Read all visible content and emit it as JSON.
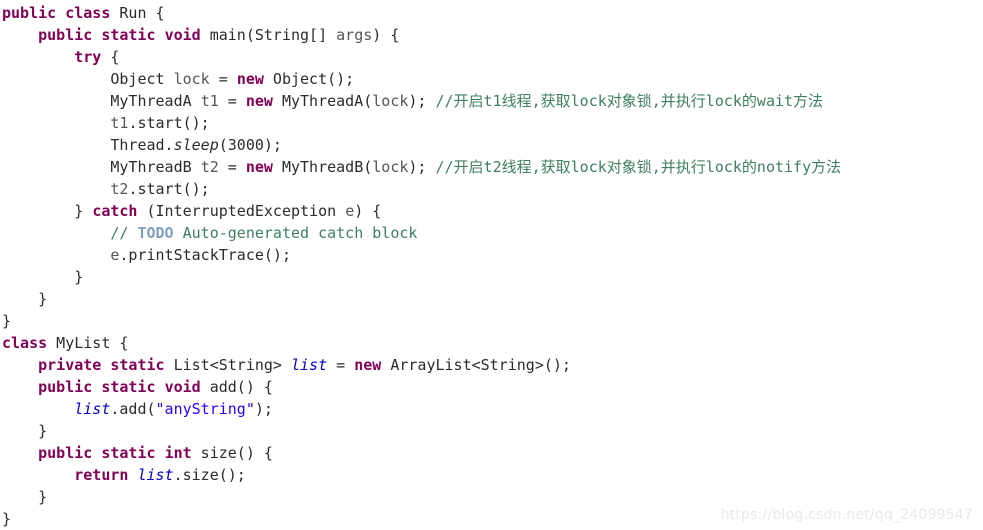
{
  "editor": {
    "background_color": "#ffffff",
    "default_text_color": "#2b2b2b",
    "keyword_color": "#7f0055",
    "comment_color": "#3f7f5f",
    "todo_color": "#7f9fbf",
    "string_color": "#2a00ff",
    "static_field_color": "#0000c0",
    "language": "java"
  },
  "watermark": {
    "text": "https://blog.csdn.net/qq_24099547",
    "color": "#e8e8e8"
  },
  "code": {
    "lines": [
      {
        "indent": 0,
        "tokens": [
          {
            "t": "public",
            "k": "keyword"
          },
          {
            "t": " ",
            "k": "plain"
          },
          {
            "t": "class",
            "k": "keyword"
          },
          {
            "t": " Run {",
            "k": "plain"
          }
        ]
      },
      {
        "indent": 1,
        "tokens": [
          {
            "t": "public",
            "k": "keyword"
          },
          {
            "t": " ",
            "k": "plain"
          },
          {
            "t": "static",
            "k": "keyword"
          },
          {
            "t": " ",
            "k": "plain"
          },
          {
            "t": "void",
            "k": "keyword"
          },
          {
            "t": " main(String[] ",
            "k": "plain"
          },
          {
            "t": "args",
            "k": "local"
          },
          {
            "t": ") {",
            "k": "plain"
          }
        ]
      },
      {
        "indent": 2,
        "tokens": [
          {
            "t": "try",
            "k": "keyword"
          },
          {
            "t": " {",
            "k": "plain"
          }
        ]
      },
      {
        "indent": 3,
        "tokens": [
          {
            "t": "Object ",
            "k": "plain"
          },
          {
            "t": "lock",
            "k": "local"
          },
          {
            "t": " = ",
            "k": "plain"
          },
          {
            "t": "new",
            "k": "keyword"
          },
          {
            "t": " Object();",
            "k": "plain"
          }
        ]
      },
      {
        "indent": 3,
        "tokens": [
          {
            "t": "MyThreadA ",
            "k": "plain"
          },
          {
            "t": "t1",
            "k": "local"
          },
          {
            "t": " = ",
            "k": "plain"
          },
          {
            "t": "new",
            "k": "keyword"
          },
          {
            "t": " MyThreadA(",
            "k": "plain"
          },
          {
            "t": "lock",
            "k": "local"
          },
          {
            "t": "); ",
            "k": "plain"
          },
          {
            "t": "//开启t1线程,获取lock对象锁,并执行lock的wait方法",
            "k": "comment"
          }
        ]
      },
      {
        "indent": 3,
        "tokens": [
          {
            "t": "t1",
            "k": "local"
          },
          {
            "t": ".start();",
            "k": "plain"
          }
        ]
      },
      {
        "indent": 3,
        "tokens": [
          {
            "t": "Thread.",
            "k": "plain"
          },
          {
            "t": "sleep",
            "k": "static-method"
          },
          {
            "t": "(3000);",
            "k": "plain"
          }
        ]
      },
      {
        "indent": 3,
        "tokens": [
          {
            "t": "MyThreadB ",
            "k": "plain"
          },
          {
            "t": "t2",
            "k": "local"
          },
          {
            "t": " = ",
            "k": "plain"
          },
          {
            "t": "new",
            "k": "keyword"
          },
          {
            "t": " MyThreadB(",
            "k": "plain"
          },
          {
            "t": "lock",
            "k": "local"
          },
          {
            "t": "); ",
            "k": "plain"
          },
          {
            "t": "//开启t2线程,获取lock对象锁,并执行lock的notify方法",
            "k": "comment"
          }
        ]
      },
      {
        "indent": 3,
        "tokens": [
          {
            "t": "t2",
            "k": "local"
          },
          {
            "t": ".start();",
            "k": "plain"
          }
        ]
      },
      {
        "indent": 2,
        "tokens": [
          {
            "t": "} ",
            "k": "plain"
          },
          {
            "t": "catch",
            "k": "keyword"
          },
          {
            "t": " (InterruptedException ",
            "k": "plain"
          },
          {
            "t": "e",
            "k": "local"
          },
          {
            "t": ") {",
            "k": "plain"
          }
        ]
      },
      {
        "indent": 3,
        "tokens": [
          {
            "t": "// ",
            "k": "comment"
          },
          {
            "t": "TODO",
            "k": "todo"
          },
          {
            "t": " Auto-generated catch block",
            "k": "comment"
          }
        ]
      },
      {
        "indent": 3,
        "tokens": [
          {
            "t": "e",
            "k": "local"
          },
          {
            "t": ".printStackTrace();",
            "k": "plain"
          }
        ]
      },
      {
        "indent": 2,
        "tokens": [
          {
            "t": "}",
            "k": "plain"
          }
        ]
      },
      {
        "indent": 1,
        "tokens": [
          {
            "t": "}",
            "k": "plain"
          }
        ]
      },
      {
        "indent": 0,
        "tokens": [
          {
            "t": "}",
            "k": "plain"
          }
        ]
      },
      {
        "indent": 0,
        "tokens": [
          {
            "t": "class",
            "k": "keyword"
          },
          {
            "t": " MyList {",
            "k": "plain"
          }
        ]
      },
      {
        "indent": 1,
        "tokens": [
          {
            "t": "private",
            "k": "keyword"
          },
          {
            "t": " ",
            "k": "plain"
          },
          {
            "t": "static",
            "k": "keyword"
          },
          {
            "t": " List<String> ",
            "k": "plain"
          },
          {
            "t": "list",
            "k": "static-field"
          },
          {
            "t": " = ",
            "k": "plain"
          },
          {
            "t": "new",
            "k": "keyword"
          },
          {
            "t": " ArrayList<String>();",
            "k": "plain"
          }
        ]
      },
      {
        "indent": 1,
        "tokens": [
          {
            "t": "public",
            "k": "keyword"
          },
          {
            "t": " ",
            "k": "plain"
          },
          {
            "t": "static",
            "k": "keyword"
          },
          {
            "t": " ",
            "k": "plain"
          },
          {
            "t": "void",
            "k": "keyword"
          },
          {
            "t": " add() {",
            "k": "plain"
          }
        ]
      },
      {
        "indent": 2,
        "tokens": [
          {
            "t": "list",
            "k": "static-field"
          },
          {
            "t": ".add(",
            "k": "plain"
          },
          {
            "t": "\"anyString\"",
            "k": "string"
          },
          {
            "t": ");",
            "k": "plain"
          }
        ]
      },
      {
        "indent": 1,
        "tokens": [
          {
            "t": "}",
            "k": "plain"
          }
        ]
      },
      {
        "indent": 1,
        "tokens": [
          {
            "t": "public",
            "k": "keyword"
          },
          {
            "t": " ",
            "k": "plain"
          },
          {
            "t": "static",
            "k": "keyword"
          },
          {
            "t": " ",
            "k": "plain"
          },
          {
            "t": "int",
            "k": "keyword"
          },
          {
            "t": " size() {",
            "k": "plain"
          }
        ]
      },
      {
        "indent": 2,
        "tokens": [
          {
            "t": "return",
            "k": "keyword"
          },
          {
            "t": " ",
            "k": "plain"
          },
          {
            "t": "list",
            "k": "static-field"
          },
          {
            "t": ".size();",
            "k": "plain"
          }
        ]
      },
      {
        "indent": 1,
        "tokens": [
          {
            "t": "}",
            "k": "plain"
          }
        ]
      },
      {
        "indent": 0,
        "tokens": [
          {
            "t": "}",
            "k": "plain"
          }
        ]
      }
    ]
  }
}
